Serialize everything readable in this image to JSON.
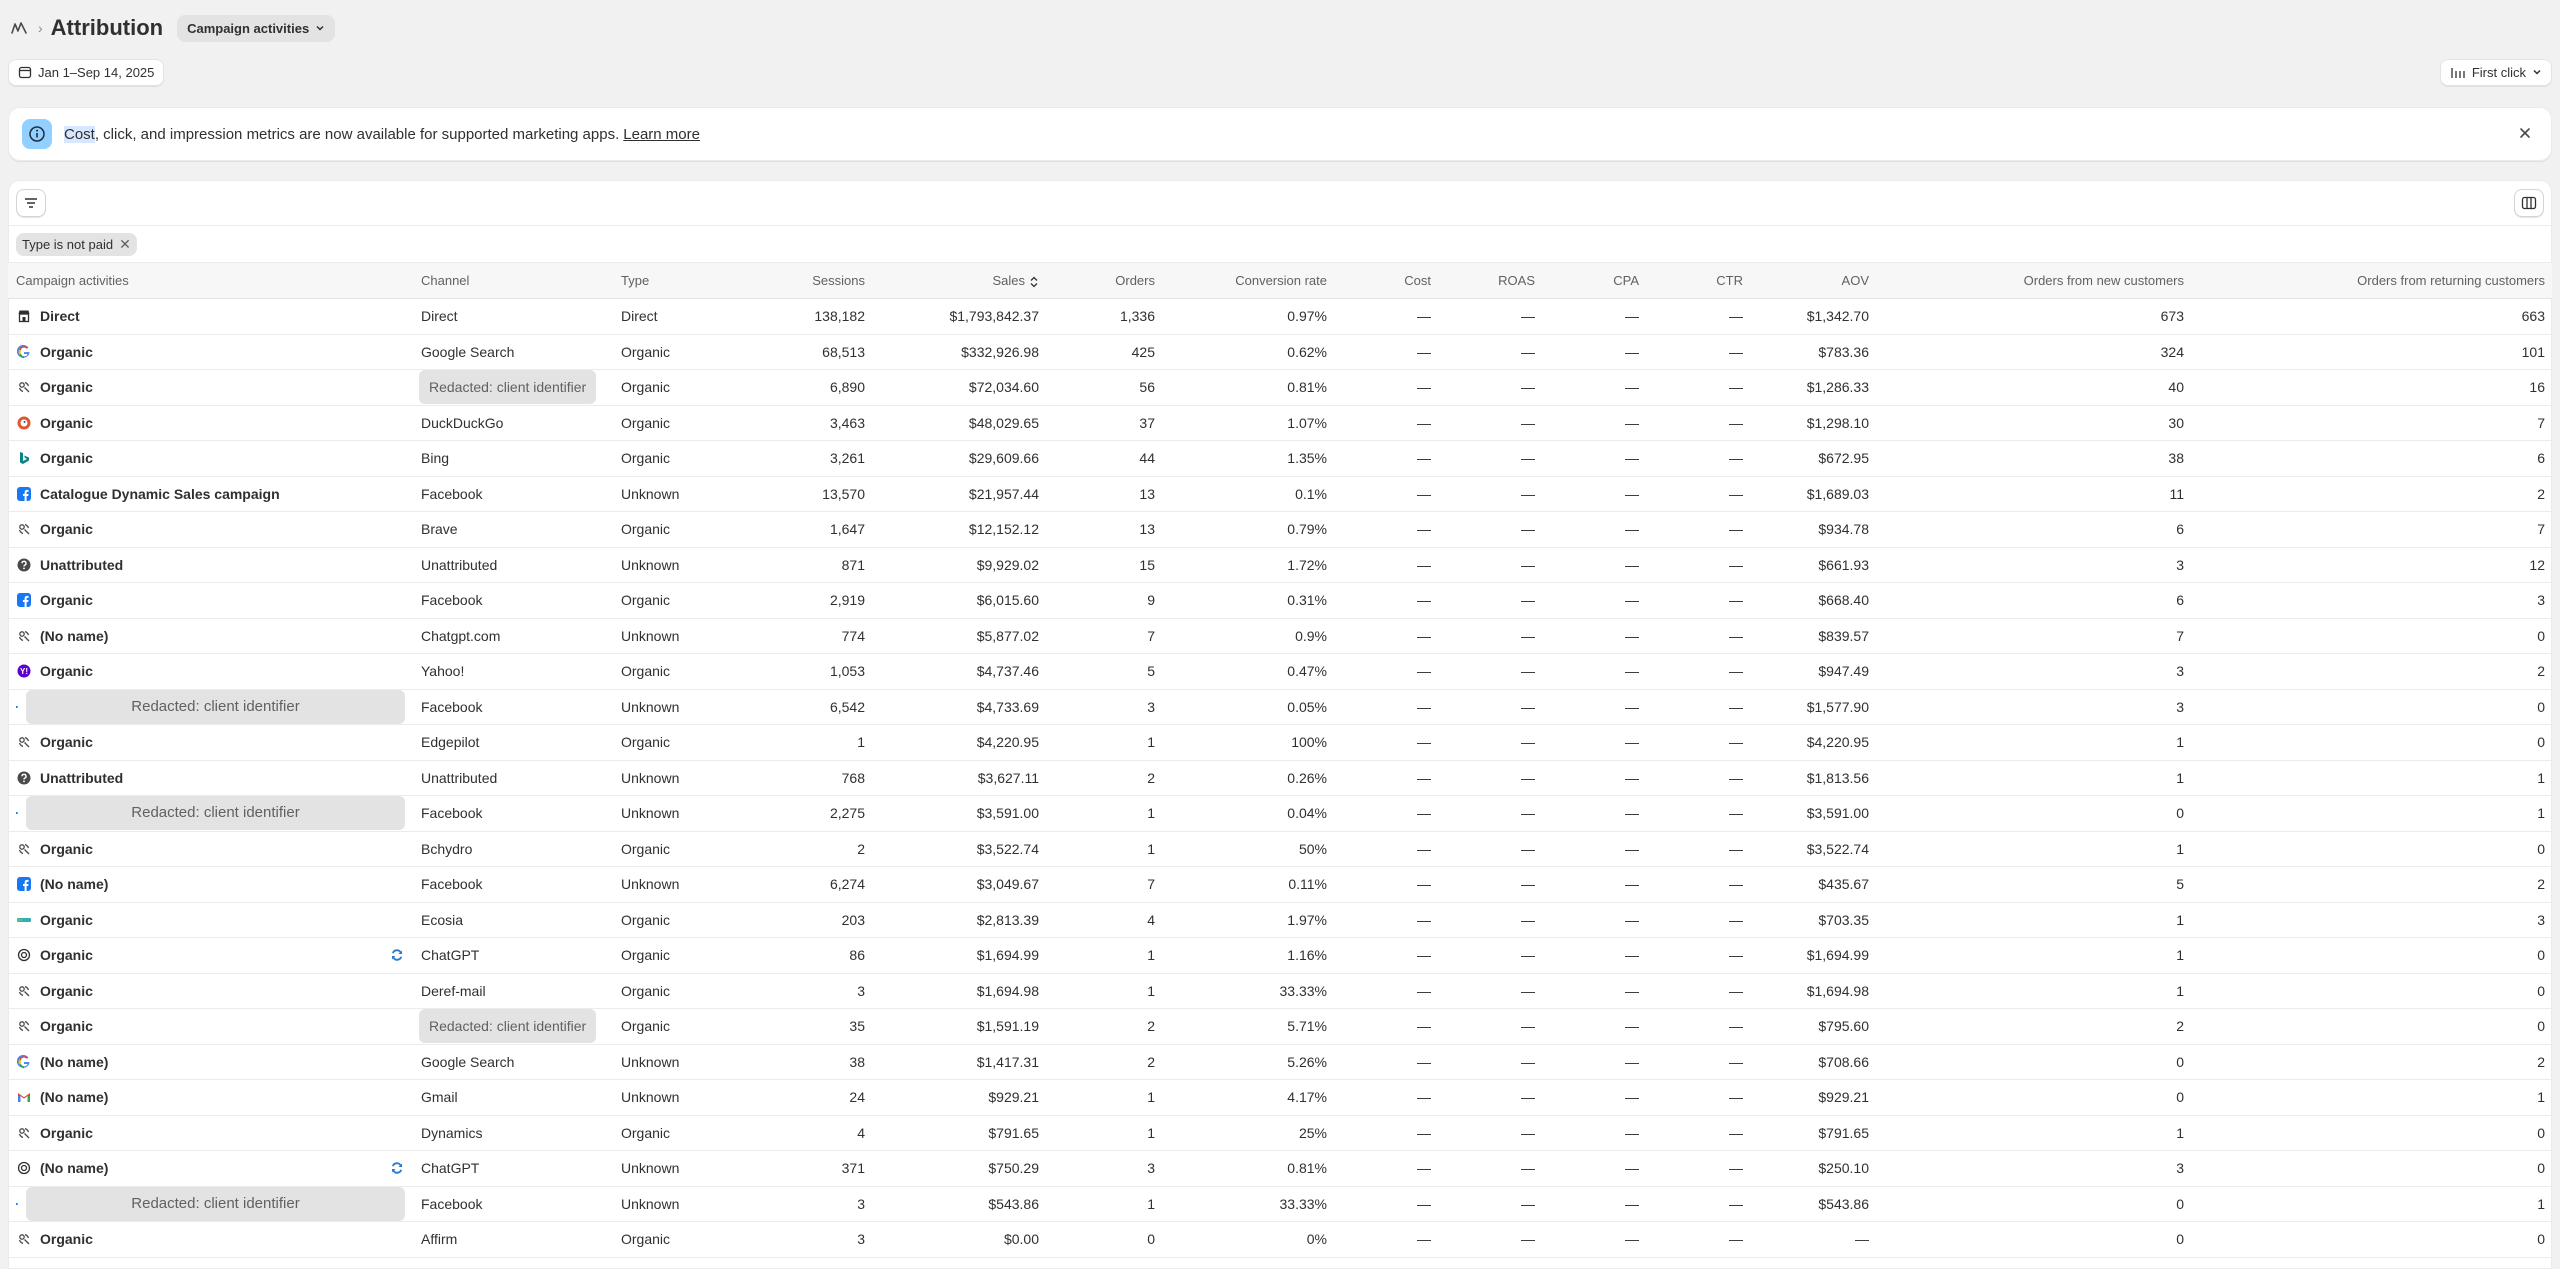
{
  "header": {
    "title": "Attribution",
    "report_selector": "Campaign activities"
  },
  "toolbar": {
    "date_range": "Jan 1–Sep 14, 2025",
    "attribution_model": "First click"
  },
  "banner": {
    "highlight": "Cost",
    "text": ", click, and impression metrics are now available for supported marketing apps.",
    "link": "Learn more"
  },
  "filter_chip": "Type is not paid",
  "redacted_label": "Redacted: client identifier",
  "columns": [
    "Campaign activities",
    "Channel",
    "Type",
    "Sessions",
    "Sales",
    "Orders",
    "Conversion rate",
    "Cost",
    "ROAS",
    "CPA",
    "CTR",
    "AOV",
    "Orders from new customers",
    "Orders from returning customers"
  ],
  "rows": [
    {
      "icon": "store-icon",
      "campaign": "Direct",
      "channel": "Direct",
      "type": "Direct",
      "sessions": "138,182",
      "sales": "$1,793,842.37",
      "orders": "1,336",
      "conversion": "0.97%",
      "cost": "—",
      "roas": "—",
      "cpa": "—",
      "ctr": "—",
      "aov": "$1,342.70",
      "new": "673",
      "returning": "663"
    },
    {
      "icon": "google-icon",
      "campaign": "Organic",
      "channel": "Google Search",
      "type": "Organic",
      "sessions": "68,513",
      "sales": "$332,926.98",
      "orders": "425",
      "conversion": "0.62%",
      "cost": "—",
      "roas": "—",
      "cpa": "—",
      "ctr": "—",
      "aov": "$783.36",
      "new": "324",
      "returning": "101"
    },
    {
      "icon": "referral-icon",
      "campaign": "Organic",
      "channel": "Redacted: client identifier",
      "type": "Organic",
      "sessions": "6,890",
      "sales": "$72,034.60",
      "orders": "56",
      "conversion": "0.81%",
      "cost": "—",
      "roas": "—",
      "cpa": "—",
      "ctr": "—",
      "aov": "$1,286.33",
      "new": "40",
      "returning": "16"
    },
    {
      "icon": "duckduckgo-icon",
      "campaign": "Organic",
      "channel": "DuckDuckGo",
      "type": "Organic",
      "sessions": "3,463",
      "sales": "$48,029.65",
      "orders": "37",
      "conversion": "1.07%",
      "cost": "—",
      "roas": "—",
      "cpa": "—",
      "ctr": "—",
      "aov": "$1,298.10",
      "new": "30",
      "returning": "7"
    },
    {
      "icon": "bing-icon",
      "campaign": "Organic",
      "channel": "Bing",
      "type": "Organic",
      "sessions": "3,261",
      "sales": "$29,609.66",
      "orders": "44",
      "conversion": "1.35%",
      "cost": "—",
      "roas": "—",
      "cpa": "—",
      "ctr": "—",
      "aov": "$672.95",
      "new": "38",
      "returning": "6"
    },
    {
      "icon": "facebook-icon",
      "campaign": "Catalogue Dynamic Sales campaign",
      "channel": "Facebook",
      "type": "Unknown",
      "sessions": "13,570",
      "sales": "$21,957.44",
      "orders": "13",
      "conversion": "0.1%",
      "cost": "—",
      "roas": "—",
      "cpa": "—",
      "ctr": "—",
      "aov": "$1,689.03",
      "new": "11",
      "returning": "2"
    },
    {
      "icon": "referral-icon",
      "campaign": "Organic",
      "channel": "Brave",
      "type": "Organic",
      "sessions": "1,647",
      "sales": "$12,152.12",
      "orders": "13",
      "conversion": "0.79%",
      "cost": "—",
      "roas": "—",
      "cpa": "—",
      "ctr": "—",
      "aov": "$934.78",
      "new": "6",
      "returning": "7"
    },
    {
      "icon": "question-icon",
      "campaign": "Unattributed",
      "channel": "Unattributed",
      "type": "Unknown",
      "sessions": "871",
      "sales": "$9,929.02",
      "orders": "15",
      "conversion": "1.72%",
      "cost": "—",
      "roas": "—",
      "cpa": "—",
      "ctr": "—",
      "aov": "$661.93",
      "new": "3",
      "returning": "12"
    },
    {
      "icon": "facebook-icon",
      "campaign": "Organic",
      "channel": "Facebook",
      "type": "Organic",
      "sessions": "2,919",
      "sales": "$6,015.60",
      "orders": "9",
      "conversion": "0.31%",
      "cost": "—",
      "roas": "—",
      "cpa": "—",
      "ctr": "—",
      "aov": "$668.40",
      "new": "6",
      "returning": "3"
    },
    {
      "icon": "referral-icon",
      "campaign": "(No name)",
      "channel": "Chatgpt.com",
      "type": "Unknown",
      "sessions": "774",
      "sales": "$5,877.02",
      "orders": "7",
      "conversion": "0.9%",
      "cost": "—",
      "roas": "—",
      "cpa": "—",
      "ctr": "—",
      "aov": "$839.57",
      "new": "7",
      "returning": "0"
    },
    {
      "icon": "yahoo-icon",
      "campaign": "Organic",
      "channel": "Yahoo!",
      "type": "Organic",
      "sessions": "1,053",
      "sales": "$4,737.46",
      "orders": "5",
      "conversion": "0.47%",
      "cost": "—",
      "roas": "—",
      "cpa": "—",
      "ctr": "—",
      "aov": "$947.49",
      "new": "3",
      "returning": "2"
    },
    {
      "icon": "facebook-icon",
      "campaign": "Redacted: client identifier",
      "channel": "Facebook",
      "type": "Unknown",
      "sessions": "6,542",
      "sales": "$4,733.69",
      "orders": "3",
      "conversion": "0.05%",
      "cost": "—",
      "roas": "—",
      "cpa": "—",
      "ctr": "—",
      "aov": "$1,577.90",
      "new": "3",
      "returning": "0"
    },
    {
      "icon": "referral-icon",
      "campaign": "Organic",
      "channel": "Edgepilot",
      "type": "Organic",
      "sessions": "1",
      "sales": "$4,220.95",
      "orders": "1",
      "conversion": "100%",
      "cost": "—",
      "roas": "—",
      "cpa": "—",
      "ctr": "—",
      "aov": "$4,220.95",
      "new": "1",
      "returning": "0"
    },
    {
      "icon": "question-icon",
      "campaign": "Unattributed",
      "channel": "Unattributed",
      "type": "Unknown",
      "sessions": "768",
      "sales": "$3,627.11",
      "orders": "2",
      "conversion": "0.26%",
      "cost": "—",
      "roas": "—",
      "cpa": "—",
      "ctr": "—",
      "aov": "$1,813.56",
      "new": "1",
      "returning": "1"
    },
    {
      "icon": "facebook-icon",
      "campaign": "Redacted: client identifier",
      "channel": "Facebook",
      "type": "Unknown",
      "sessions": "2,275",
      "sales": "$3,591.00",
      "orders": "1",
      "conversion": "0.04%",
      "cost": "—",
      "roas": "—",
      "cpa": "—",
      "ctr": "—",
      "aov": "$3,591.00",
      "new": "0",
      "returning": "1"
    },
    {
      "icon": "referral-icon",
      "campaign": "Organic",
      "channel": "Bchydro",
      "type": "Organic",
      "sessions": "2",
      "sales": "$3,522.74",
      "orders": "1",
      "conversion": "50%",
      "cost": "—",
      "roas": "—",
      "cpa": "—",
      "ctr": "—",
      "aov": "$3,522.74",
      "new": "1",
      "returning": "0"
    },
    {
      "icon": "facebook-icon",
      "campaign": "(No name)",
      "channel": "Facebook",
      "type": "Unknown",
      "sessions": "6,274",
      "sales": "$3,049.67",
      "orders": "7",
      "conversion": "0.11%",
      "cost": "—",
      "roas": "—",
      "cpa": "—",
      "ctr": "—",
      "aov": "$435.67",
      "new": "5",
      "returning": "2"
    },
    {
      "icon": "ecosia-icon",
      "campaign": "Organic",
      "channel": "Ecosia",
      "type": "Organic",
      "sessions": "203",
      "sales": "$2,813.39",
      "orders": "4",
      "conversion": "1.97%",
      "cost": "—",
      "roas": "—",
      "cpa": "—",
      "ctr": "—",
      "aov": "$703.35",
      "new": "1",
      "returning": "3"
    },
    {
      "icon": "chatgpt-icon",
      "campaign": "Organic",
      "sync": true,
      "channel": "ChatGPT",
      "type": "Organic",
      "sessions": "86",
      "sales": "$1,694.99",
      "orders": "1",
      "conversion": "1.16%",
      "cost": "—",
      "roas": "—",
      "cpa": "—",
      "ctr": "—",
      "aov": "$1,694.99",
      "new": "1",
      "returning": "0"
    },
    {
      "icon": "referral-icon",
      "campaign": "Organic",
      "channel": "Deref-mail",
      "type": "Organic",
      "sessions": "3",
      "sales": "$1,694.98",
      "orders": "1",
      "conversion": "33.33%",
      "cost": "—",
      "roas": "—",
      "cpa": "—",
      "ctr": "—",
      "aov": "$1,694.98",
      "new": "1",
      "returning": "0"
    },
    {
      "icon": "referral-icon",
      "campaign": "Organic",
      "channel": "Redacted: client identifier",
      "type": "Organic",
      "sessions": "35",
      "sales": "$1,591.19",
      "orders": "2",
      "conversion": "5.71%",
      "cost": "—",
      "roas": "—",
      "cpa": "—",
      "ctr": "—",
      "aov": "$795.60",
      "new": "2",
      "returning": "0"
    },
    {
      "icon": "google-icon",
      "campaign": "(No name)",
      "channel": "Google Search",
      "type": "Unknown",
      "sessions": "38",
      "sales": "$1,417.31",
      "orders": "2",
      "conversion": "5.26%",
      "cost": "—",
      "roas": "—",
      "cpa": "—",
      "ctr": "—",
      "aov": "$708.66",
      "new": "0",
      "returning": "2"
    },
    {
      "icon": "gmail-icon",
      "campaign": "(No name)",
      "channel": "Gmail",
      "type": "Unknown",
      "sessions": "24",
      "sales": "$929.21",
      "orders": "1",
      "conversion": "4.17%",
      "cost": "—",
      "roas": "—",
      "cpa": "—",
      "ctr": "—",
      "aov": "$929.21",
      "new": "0",
      "returning": "1"
    },
    {
      "icon": "referral-icon",
      "campaign": "Organic",
      "channel": "Dynamics",
      "type": "Organic",
      "sessions": "4",
      "sales": "$791.65",
      "orders": "1",
      "conversion": "25%",
      "cost": "—",
      "roas": "—",
      "cpa": "—",
      "ctr": "—",
      "aov": "$791.65",
      "new": "1",
      "returning": "0"
    },
    {
      "icon": "chatgpt-icon",
      "campaign": "(No name)",
      "sync": true,
      "channel": "ChatGPT",
      "type": "Unknown",
      "sessions": "371",
      "sales": "$750.29",
      "orders": "3",
      "conversion": "0.81%",
      "cost": "—",
      "roas": "—",
      "cpa": "—",
      "ctr": "—",
      "aov": "$250.10",
      "new": "3",
      "returning": "0"
    },
    {
      "icon": "facebook-icon",
      "campaign": "Redacted: client identifier",
      "channel": "Facebook",
      "type": "Unknown",
      "sessions": "3",
      "sales": "$543.86",
      "orders": "1",
      "conversion": "33.33%",
      "cost": "—",
      "roas": "—",
      "cpa": "—",
      "ctr": "—",
      "aov": "$543.86",
      "new": "0",
      "returning": "1"
    },
    {
      "icon": "referral-icon",
      "campaign": "Organic",
      "channel": "Affirm",
      "type": "Organic",
      "sessions": "3",
      "sales": "$0.00",
      "orders": "0",
      "conversion": "0%",
      "cost": "—",
      "roas": "—",
      "cpa": "—",
      "ctr": "—",
      "aov": "—",
      "new": "0",
      "returning": "0"
    }
  ]
}
